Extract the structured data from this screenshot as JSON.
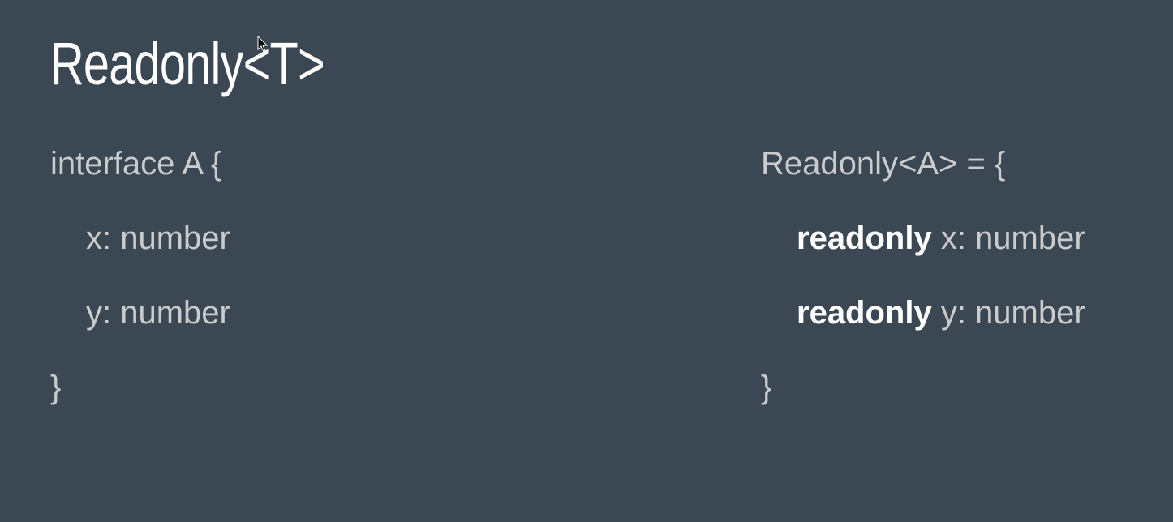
{
  "slide": {
    "title": "Readonly<T>",
    "left_block": {
      "line1": "interface A {",
      "line2": "x: number",
      "line3": "y: number",
      "line4": "}"
    },
    "right_block": {
      "line1": "Readonly<A> = {",
      "line2_keyword": "readonly",
      "line2_rest": " x: number",
      "line3_keyword": "readonly",
      "line3_rest": " y: number",
      "line4": "}"
    }
  },
  "colors": {
    "background": "#3b4752",
    "text": "#c9cbcd",
    "emphasis": "#ffffff"
  },
  "icons": {
    "cursor": "mouse-pointer-icon"
  }
}
